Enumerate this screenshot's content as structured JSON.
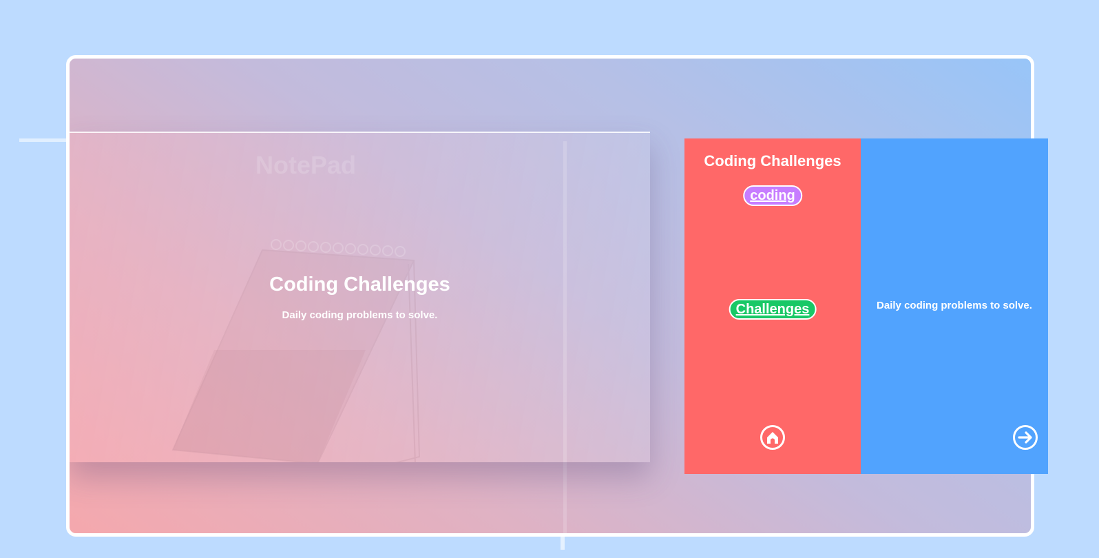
{
  "hero": {
    "watermark": "NotePad",
    "title": "Coding Challenges",
    "subtitle": "Daily coding problems to solve."
  },
  "card_red": {
    "title": "Coding Challenges",
    "tag1": "coding",
    "tag2": "Challenges",
    "icon": "home-icon",
    "color": "#ff6868"
  },
  "card_blue": {
    "description": "Daily coding problems to solve.",
    "icon": "arrow-right-icon",
    "color": "#51a3fe"
  },
  "colors": {
    "background": "#bddbff",
    "tag_coding": "#c77dff",
    "tag_challenges": "#18c866"
  }
}
